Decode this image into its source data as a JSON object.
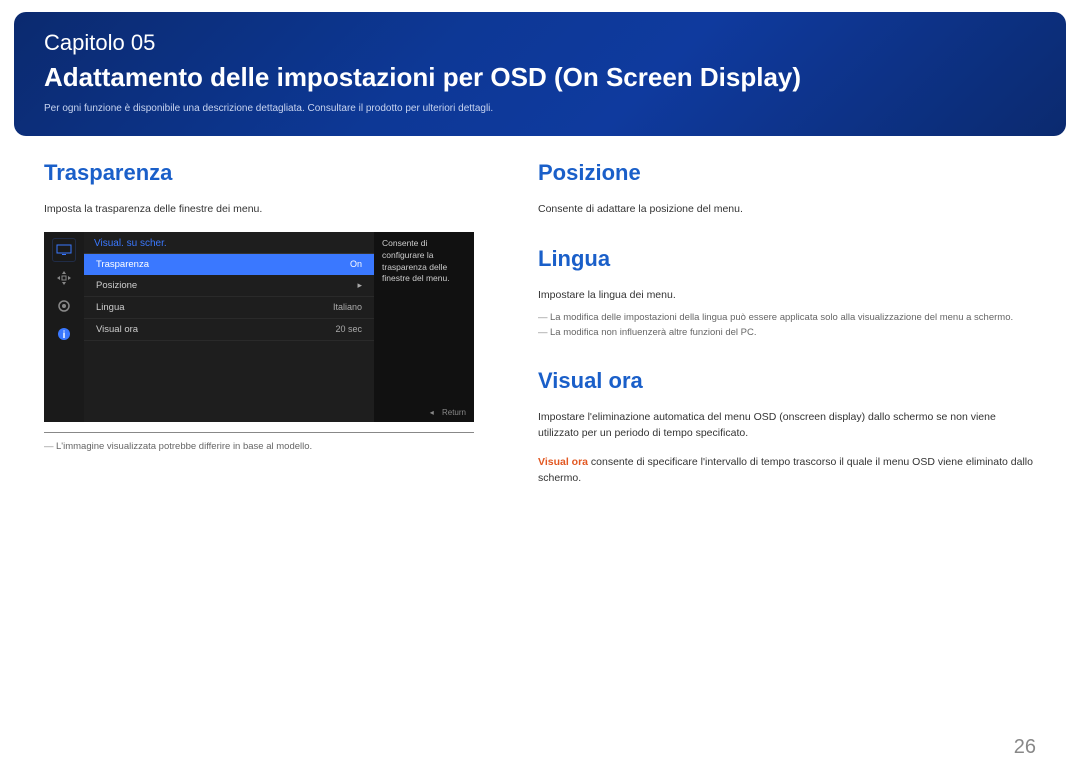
{
  "header": {
    "chapter": "Capitolo 05",
    "title": "Adattamento delle impostazioni per OSD (On Screen Display)",
    "subtitle": "Per ogni funzione è disponibile una descrizione dettagliata. Consultare il prodotto per ulteriori dettagli."
  },
  "left": {
    "heading": "Trasparenza",
    "desc": "Imposta la trasparenza delle finestre dei menu.",
    "footnote": "L'immagine visualizzata potrebbe differire in base al modello."
  },
  "osd": {
    "category": "Visual. su scher.",
    "rows": [
      {
        "label": "Trasparenza",
        "value": "On",
        "selected": true
      },
      {
        "label": "Posizione",
        "value": "▸",
        "selected": false
      },
      {
        "label": "Lingua",
        "value": "Italiano",
        "selected": false
      },
      {
        "label": "Visual ora",
        "value": "20 sec",
        "selected": false
      }
    ],
    "help": "Consente di configurare la trasparenza delle finestre del menu.",
    "return_label": "Return"
  },
  "right": {
    "posizione": {
      "heading": "Posizione",
      "desc": "Consente di adattare la posizione del menu."
    },
    "lingua": {
      "heading": "Lingua",
      "desc": "Impostare la lingua dei menu.",
      "note1": "La modifica delle impostazioni della lingua può essere applicata solo alla visualizzazione del menu a schermo.",
      "note2": "La modifica non influenzerà altre funzioni del PC."
    },
    "visualora": {
      "heading": "Visual ora",
      "desc1": "Impostare l'eliminazione automatica del menu OSD (onscreen display) dallo schermo se non viene utilizzato per un periodo di tempo specificato.",
      "desc2_prefix": "Visual ora",
      "desc2_rest": " consente di specificare l'intervallo di tempo trascorso il quale il menu OSD viene eliminato dallo schermo."
    }
  },
  "page_number": "26"
}
